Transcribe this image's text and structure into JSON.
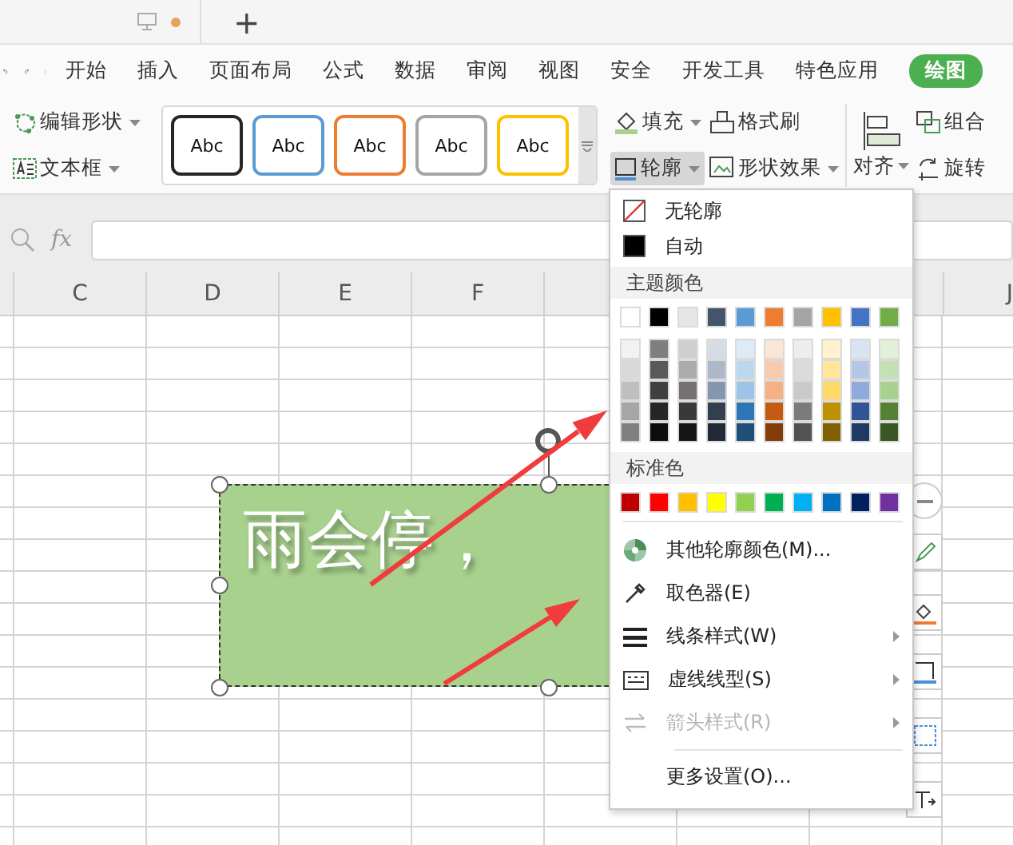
{
  "document_tab": {
    "unsaved": true,
    "new_tab_label": "+"
  },
  "menu_tabs": [
    {
      "label": "开始",
      "selected": false
    },
    {
      "label": "插入",
      "selected": false
    },
    {
      "label": "页面布局",
      "selected": false
    },
    {
      "label": "公式",
      "selected": false
    },
    {
      "label": "数据",
      "selected": false
    },
    {
      "label": "审阅",
      "selected": false
    },
    {
      "label": "视图",
      "selected": false
    },
    {
      "label": "安全",
      "selected": false
    },
    {
      "label": "开发工具",
      "selected": false
    },
    {
      "label": "特色应用",
      "selected": false
    },
    {
      "label": "绘图",
      "selected": true
    }
  ],
  "ribbon": {
    "edit_shape": {
      "label": "编辑形状",
      "dropdown": true
    },
    "text_box": {
      "label": "文本框",
      "dropdown": true
    },
    "shape_styles": [
      {
        "label": "Abc",
        "color": "#262626"
      },
      {
        "label": "Abc",
        "color": "#5b9bd5"
      },
      {
        "label": "Abc",
        "color": "#ed7d31"
      },
      {
        "label": "Abc",
        "color": "#a5a5a5"
      },
      {
        "label": "Abc",
        "color": "#ffc000"
      }
    ],
    "fill": {
      "label": "填充",
      "dropdown": true
    },
    "format_painter": {
      "label": "格式刷"
    },
    "outline": {
      "label": "轮廓",
      "dropdown": true,
      "pressed": true
    },
    "shape_effects": {
      "label": "形状效果",
      "dropdown": true
    },
    "align": {
      "label": "对齐",
      "dropdown": true
    },
    "group": {
      "label": "组合"
    },
    "rotate": {
      "label": "旋转"
    }
  },
  "formula_bar": {
    "fx_label": "fx"
  },
  "column_headers": [
    "C",
    "D",
    "E",
    "F",
    "J"
  ],
  "shape": {
    "text": "雨会停，"
  },
  "outline_menu": {
    "top_items": [
      {
        "label": "无轮廓"
      },
      {
        "label": "自动"
      }
    ],
    "theme_title": "主题颜色",
    "theme_colors": [
      {
        "color": "#ffffff"
      },
      {
        "color": "#000000"
      },
      {
        "color": "#e7e6e6"
      },
      {
        "color": "#44546a"
      },
      {
        "color": "#5b9bd5"
      },
      {
        "color": "#ed7d31"
      },
      {
        "color": "#a5a5a5"
      },
      {
        "color": "#ffc000"
      },
      {
        "color": "#4472c4"
      },
      {
        "color": "#70ad47"
      }
    ],
    "theme_shades": [
      [
        {
          "color": "#f2f2f2"
        },
        {
          "color": "#7f7f7f"
        },
        {
          "color": "#d0cece"
        },
        {
          "color": "#d6dce4"
        },
        {
          "color": "#deebf6"
        },
        {
          "color": "#fbe5d5"
        },
        {
          "color": "#ededed"
        },
        {
          "color": "#fff2cc"
        },
        {
          "color": "#dae3f3"
        },
        {
          "color": "#e2f0d9"
        }
      ],
      [
        {
          "color": "#d9d9d9"
        },
        {
          "color": "#595959"
        },
        {
          "color": "#aeaaaa"
        },
        {
          "color": "#adb9ca"
        },
        {
          "color": "#bdd7ee"
        },
        {
          "color": "#f8cbad"
        },
        {
          "color": "#dbdbdb"
        },
        {
          "color": "#ffe699"
        },
        {
          "color": "#b4c7e7"
        },
        {
          "color": "#c5e0b4"
        }
      ],
      [
        {
          "color": "#bfbfbf"
        },
        {
          "color": "#404040"
        },
        {
          "color": "#757171"
        },
        {
          "color": "#8496b0"
        },
        {
          "color": "#9dc3e6"
        },
        {
          "color": "#f4b183"
        },
        {
          "color": "#c9c9c9"
        },
        {
          "color": "#ffd966"
        },
        {
          "color": "#8faadc"
        },
        {
          "color": "#a9d18e"
        }
      ],
      [
        {
          "color": "#a6a6a6"
        },
        {
          "color": "#262626"
        },
        {
          "color": "#3a3838"
        },
        {
          "color": "#323f4f"
        },
        {
          "color": "#2e75b5"
        },
        {
          "color": "#c55a11"
        },
        {
          "color": "#7b7b7b"
        },
        {
          "color": "#bf9000"
        },
        {
          "color": "#2f5597"
        },
        {
          "color": "#548235"
        }
      ],
      [
        {
          "color": "#808080"
        },
        {
          "color": "#0d0d0d"
        },
        {
          "color": "#171616"
        },
        {
          "color": "#222a35"
        },
        {
          "color": "#1f4e79"
        },
        {
          "color": "#843c0b"
        },
        {
          "color": "#525252"
        },
        {
          "color": "#7f6000"
        },
        {
          "color": "#203864"
        },
        {
          "color": "#385723"
        }
      ]
    ],
    "standard_title": "标准色",
    "standard_colors": [
      {
        "color": "#c00000"
      },
      {
        "color": "#ff0000"
      },
      {
        "color": "#ffc000"
      },
      {
        "color": "#ffff00"
      },
      {
        "color": "#92d050"
      },
      {
        "color": "#00b050"
      },
      {
        "color": "#00b0f0"
      },
      {
        "color": "#0070c0"
      },
      {
        "color": "#002060"
      },
      {
        "color": "#7030a0"
      }
    ],
    "items": [
      {
        "label": "其他轮廓颜色(M)...",
        "submenu": false,
        "disabled": false
      },
      {
        "label": "取色器(E)",
        "submenu": false,
        "disabled": false
      },
      {
        "label": "线条样式(W)",
        "submenu": true,
        "disabled": false
      },
      {
        "label": "虚线线型(S)",
        "submenu": true,
        "disabled": false
      },
      {
        "label": "箭头样式(R)",
        "submenu": true,
        "disabled": true
      }
    ],
    "footer_item": {
      "label": "更多设置(O)..."
    }
  }
}
